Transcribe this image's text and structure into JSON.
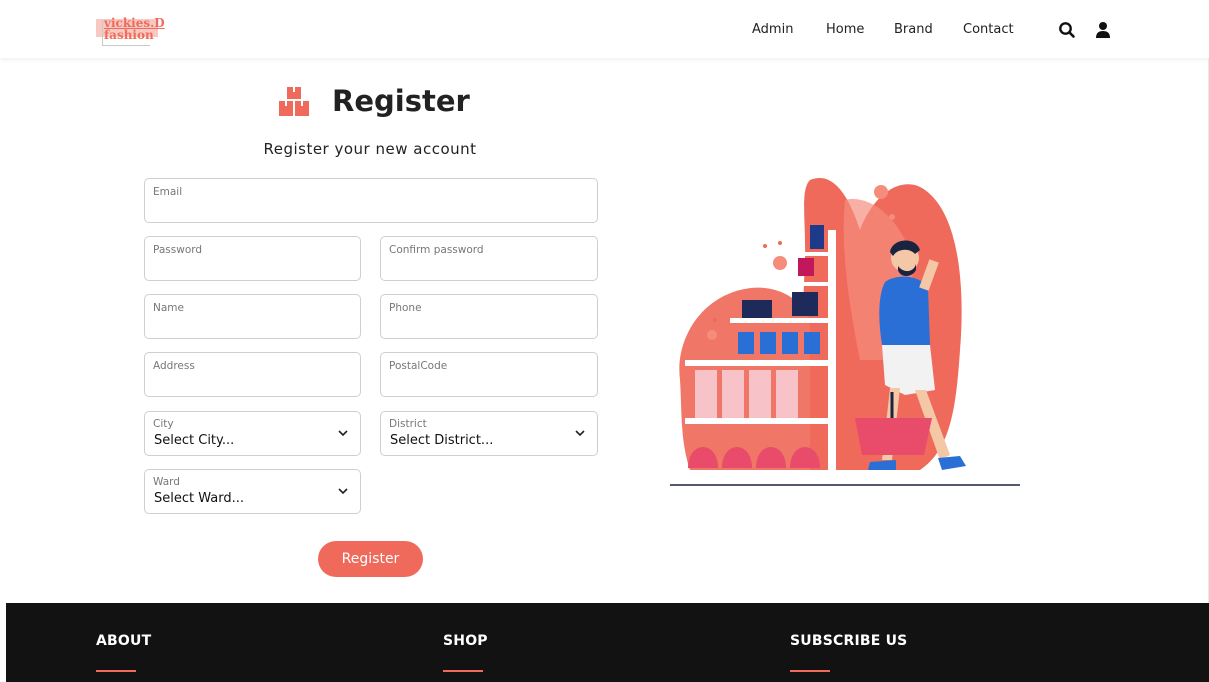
{
  "header": {
    "logo_line1": "vickies.D",
    "logo_line2": "fashion",
    "nav": [
      "Admin",
      "Home",
      "Brand",
      "Contact"
    ],
    "search_icon": "search-icon",
    "user_icon": "user-icon"
  },
  "form": {
    "title": "Register",
    "title_icon": "boxes-icon",
    "subtitle": "Register your new account",
    "email_label": "Email",
    "password_label": "Password",
    "confirm_password_label": "Confirm password",
    "name_label": "Name",
    "phone_label": "Phone",
    "address_label": "Address",
    "postal_label": "PostalCode",
    "city_label": "City",
    "city_value": "Select City...",
    "district_label": "District",
    "district_value": "Select District...",
    "ward_label": "Ward",
    "ward_value": "Select Ward...",
    "submit_label": "Register"
  },
  "footer": {
    "about": "ABOUT",
    "shop": "SHOP",
    "subscribe": "SUBSCRIBE US"
  },
  "colors": {
    "accent": "#ef6a5a",
    "footer_bg": "#121212"
  }
}
